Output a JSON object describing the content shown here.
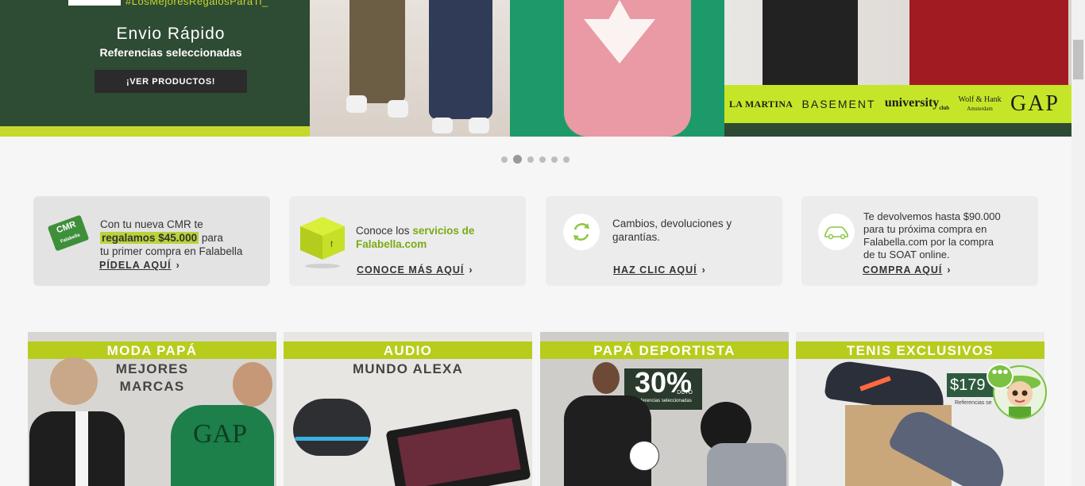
{
  "banner": {
    "hashtag": "#LosMejoresRegalosParaTi_",
    "title": "Envio Rápido",
    "subtitle": "Referencias seleccionadas",
    "cta": "¡VER PRODUCTOS!",
    "brands": [
      "LA MARTINA",
      "BASEMENT",
      "university",
      "Wolf & Hank",
      "GAP"
    ],
    "brand_sub": {
      "university": "club",
      "wolf": "Amsterdam"
    },
    "colors": {
      "green": "#2e4b34",
      "lime": "#c5e628"
    }
  },
  "carousel": {
    "dot_count": 6,
    "active_index": 1
  },
  "cards": [
    {
      "text_before": "Con tu nueva CMR te",
      "highlight": "regalamos $45.000",
      "text_after": "para",
      "text_line3": "tu primer compra en Falabella",
      "link": "PÍDELA AQUÍ",
      "icon": "cmr-card-icon",
      "icon_text": "CMR",
      "icon_subtext": "Falabella"
    },
    {
      "text_before": "Conoce los",
      "highlight": "servicios de Falabella.com",
      "link": "CONOCE MÁS AQUÍ",
      "icon": "box-icon",
      "icon_text": "f"
    },
    {
      "text": "Cambios, devoluciones y garantías.",
      "link": "HAZ CLIC AQUÍ",
      "icon": "exchange-icon"
    },
    {
      "lines": [
        "Te devolvemos hasta $90.000",
        "para tu próxima compra en",
        "Falabella.com por la compra",
        "de tu SOAT online."
      ],
      "link": "COMPRA AQUÍ",
      "icon": "car-icon"
    }
  ],
  "tiles": [
    {
      "title": "MODA PAPÁ",
      "sub": [
        "MEJORES",
        "MARCAS"
      ]
    },
    {
      "title": "AUDIO",
      "sub": [
        "MUNDO ALEXA"
      ]
    },
    {
      "title": "PAPÁ DEPORTISTA",
      "badge": "30%",
      "badge_sub": "DCTO",
      "badge_note": "Referencias seleccionadas"
    },
    {
      "title": "TENIS EXCLUSIVOS",
      "price": "$179",
      "price_note": "Referencias se"
    }
  ],
  "chat": {
    "bubble": "•••"
  }
}
